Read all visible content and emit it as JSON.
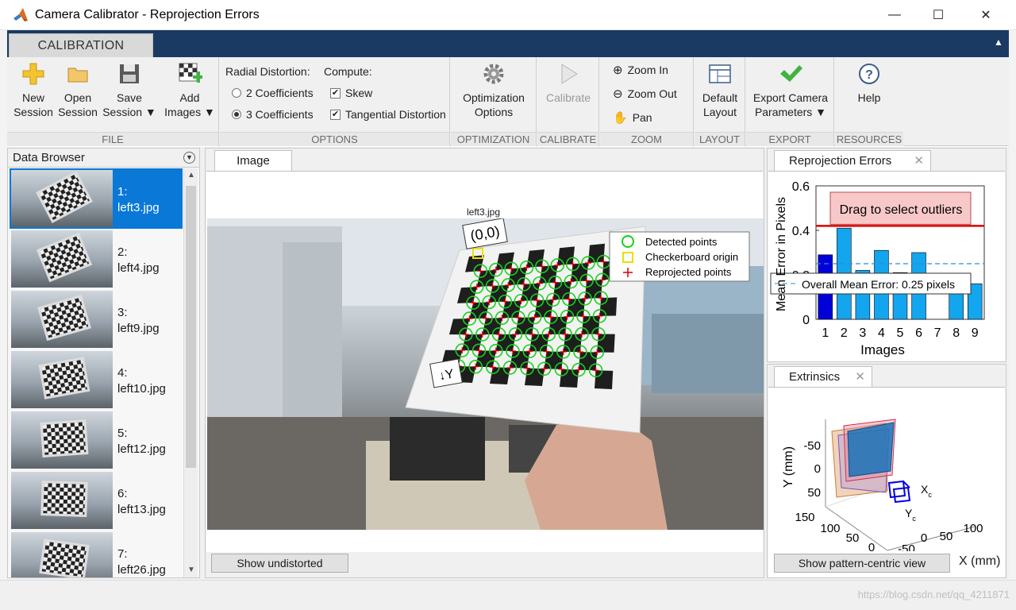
{
  "window": {
    "title": "Camera Calibrator - Reprojection Errors",
    "minimize": "—",
    "maximize": "☐",
    "close": "✕"
  },
  "tabs": {
    "calibration": "CALIBRATION"
  },
  "ribbon": {
    "file": {
      "label": "FILE",
      "new_session": [
        "New",
        "Session"
      ],
      "open_session": [
        "Open",
        "Session"
      ],
      "save_session": [
        "Save",
        "Session ▼"
      ],
      "add_images": [
        "Add",
        "Images ▼"
      ]
    },
    "options": {
      "label": "OPTIONS",
      "radial_title": "Radial Distortion:",
      "compute_title": "Compute:",
      "coef2": "2 Coefficients",
      "coef3": "3 Coefficients",
      "selected_radial": "3 Coefficients",
      "skew": "Skew",
      "tangential": "Tangential Distortion",
      "skew_checked": true,
      "tangential_checked": true
    },
    "optimization": {
      "label": "OPTIMIZATION",
      "button": [
        "Optimization",
        "Options"
      ]
    },
    "calibrate": {
      "label": "CALIBRATE",
      "button": "Calibrate"
    },
    "zoom": {
      "label": "ZOOM",
      "zoom_in": "Zoom In",
      "zoom_out": "Zoom Out",
      "pan": "Pan"
    },
    "layout": {
      "label": "LAYOUT",
      "button": [
        "Default",
        "Layout"
      ]
    },
    "export": {
      "label": "EXPORT",
      "button": [
        "Export Camera",
        "Parameters ▼"
      ]
    },
    "resources": {
      "label": "RESOURCES",
      "button": "Help"
    }
  },
  "data_browser": {
    "title": "Data Browser",
    "items": [
      {
        "num": "1:",
        "file": "left3.jpg",
        "selected": true
      },
      {
        "num": "2:",
        "file": "left4.jpg",
        "selected": false
      },
      {
        "num": "3:",
        "file": "left9.jpg",
        "selected": false
      },
      {
        "num": "4:",
        "file": "left10.jpg",
        "selected": false
      },
      {
        "num": "5:",
        "file": "left12.jpg",
        "selected": false
      },
      {
        "num": "6:",
        "file": "left13.jpg",
        "selected": false
      },
      {
        "num": "7:",
        "file": "left26.jpg",
        "selected": false
      }
    ]
  },
  "image_panel": {
    "tab": "Image",
    "image_title": "left3.jpg",
    "origin_label": "(0,0)",
    "y_label": "↓Y",
    "legend": [
      "Detected points",
      "Checkerboard origin",
      "Reprojected points"
    ],
    "show_undistorted": "Show undistorted"
  },
  "reprojection": {
    "tab": "Reprojection Errors",
    "drag_hint": "Drag to select outliers",
    "mean_label": "Overall Mean Error: 0.25 pixels",
    "ylabel": "Mean Error in Pixels",
    "xlabel": "Images"
  },
  "chart_data": {
    "type": "bar",
    "categories": [
      "1",
      "2",
      "3",
      "4",
      "5",
      "6",
      "7",
      "8",
      "9"
    ],
    "values": [
      0.29,
      0.41,
      0.22,
      0.31,
      0.21,
      0.3,
      0.0,
      0.17,
      0.16
    ],
    "selected_index": 0,
    "overall_mean": 0.25,
    "outlier_threshold": 0.42,
    "ylim": [
      0,
      0.6
    ],
    "yticks": [
      "0",
      "0.2",
      "0.4",
      "0.6"
    ],
    "xlabel": "Images",
    "ylabel": "Mean Error in Pixels",
    "colors": {
      "bar": "#13a5ee",
      "selected": "#0000d8",
      "threshold": "#e00000",
      "mean": "#2a8fd6"
    }
  },
  "extrinsics": {
    "tab": "Extrinsics",
    "yaxis_label": "Y (mm)",
    "xaxis_label": "X (mm)",
    "y_ticks": [
      "-50",
      "0",
      "50"
    ],
    "z_ticks": [
      "150",
      "100",
      "50",
      "0"
    ],
    "x_ticks": [
      "-50",
      "0",
      "50",
      "100"
    ],
    "xc": "X",
    "yc": "Y",
    "sub": "c",
    "show_pattern": "Show pattern-centric view"
  },
  "watermark": "https://blog.csdn.net/qq_4211871"
}
